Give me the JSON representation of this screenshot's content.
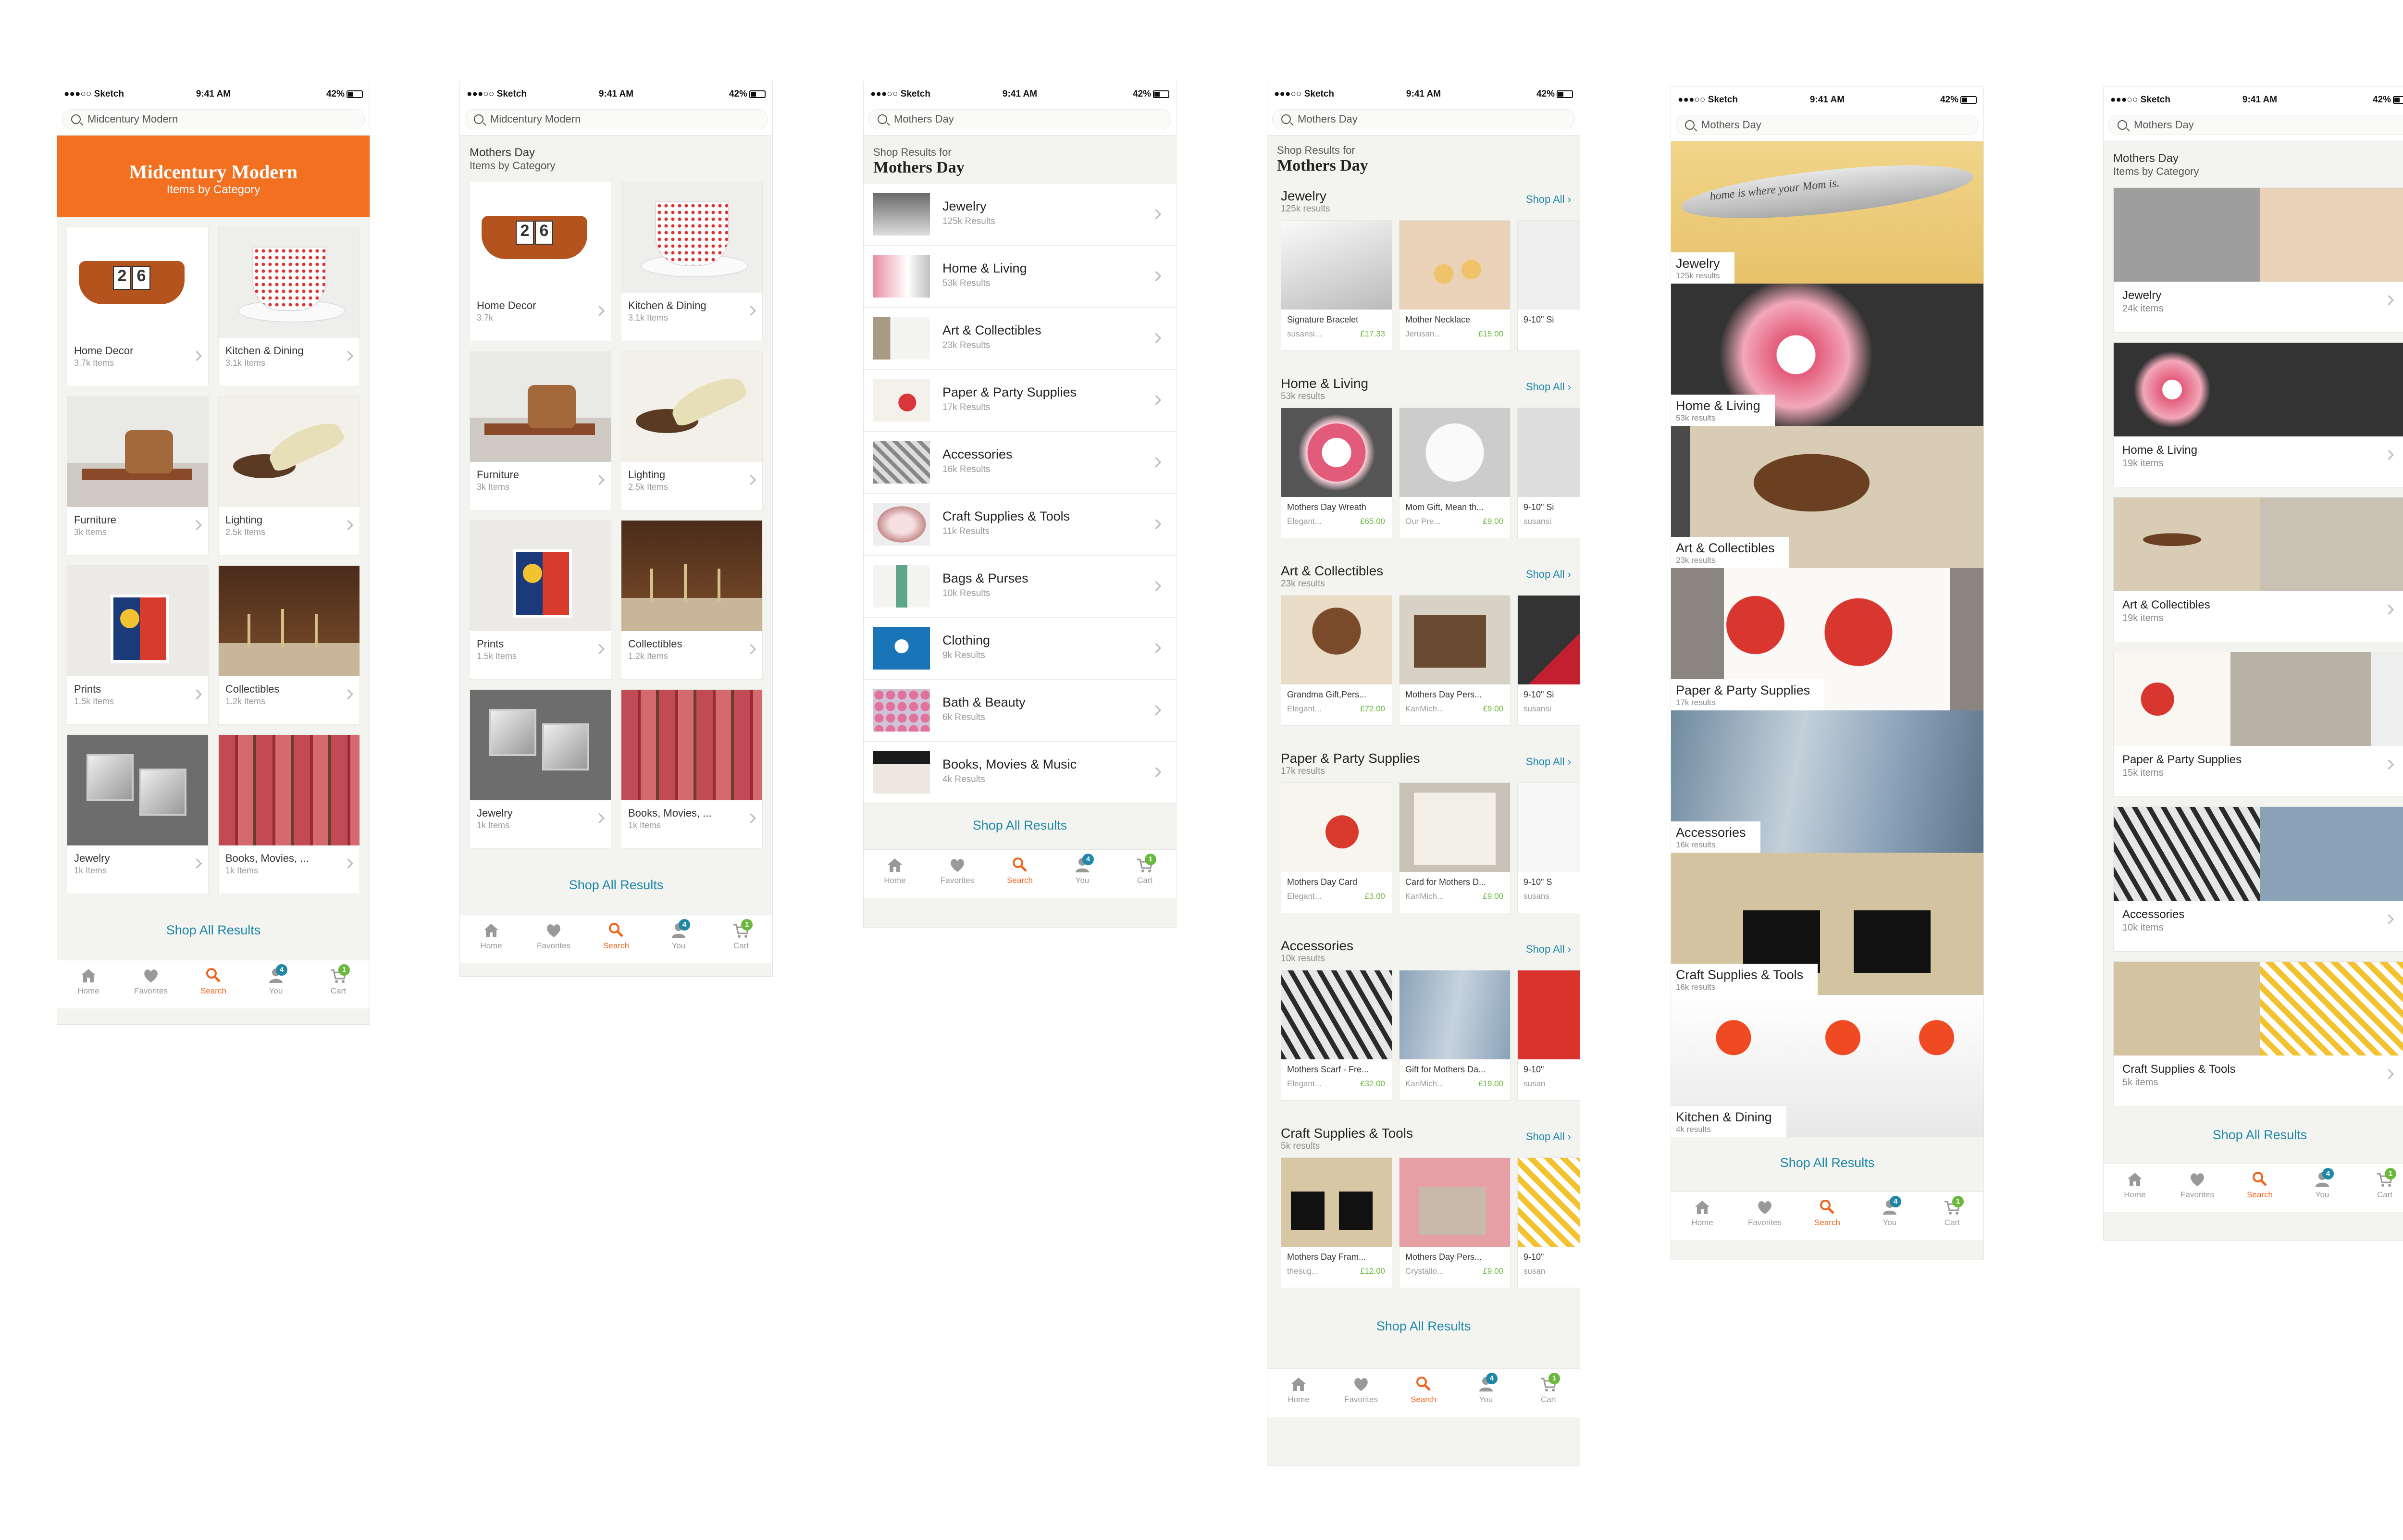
{
  "status": {
    "carrier": "●●●○○ Sketch",
    "time": "9:41 AM",
    "battery": "42%"
  },
  "tabs": [
    {
      "label": "Home",
      "icon": "home-icon"
    },
    {
      "label": "Favorites",
      "icon": "heart-icon"
    },
    {
      "label": "Search",
      "icon": "search-icon"
    },
    {
      "label": "You",
      "icon": "person-icon",
      "badge": "4"
    },
    {
      "label": "Cart",
      "icon": "cart-icon",
      "badge": "1"
    }
  ],
  "colors": {
    "accent": "#f1641e",
    "link": "#1f87a8",
    "price": "#6bb83e",
    "banner": "#f37021"
  },
  "screen1": {
    "search": "Midcentury Modern",
    "banner_title": "Midcentury Modern",
    "banner_sub": "Items by Category",
    "cards": [
      {
        "name": "Home Decor",
        "count": "3.7k Items"
      },
      {
        "name": "Kitchen & Dining",
        "count": "3.1k Items"
      },
      {
        "name": "Furniture",
        "count": "3k Items"
      },
      {
        "name": "Lighting",
        "count": "2.5k Items"
      },
      {
        "name": "Prints",
        "count": "1.5k Items"
      },
      {
        "name": "Collectibles",
        "count": "1.2k Items"
      },
      {
        "name": "Jewelry",
        "count": "1k Items"
      },
      {
        "name": "Books, Movies, ...",
        "count": "1k Items"
      }
    ],
    "shop_all": "Shop All Results"
  },
  "screen2": {
    "search": "Midcentury Modern",
    "title": "Mothers Day",
    "subtitle": "Items by Category",
    "cards": [
      {
        "name": "Home Decor",
        "count": "3.7k"
      },
      {
        "name": "Kitchen & Dining",
        "count": "3.1k Items"
      },
      {
        "name": "Furniture",
        "count": "3k Items"
      },
      {
        "name": "Lighting",
        "count": "2.5k Items"
      },
      {
        "name": "Prints",
        "count": "1.5k Items"
      },
      {
        "name": "Collectibles",
        "count": "1.2k Items"
      },
      {
        "name": "Jewelry",
        "count": "1k Items"
      },
      {
        "name": "Books, Movies, ...",
        "count": "1k Items"
      }
    ],
    "shop_all": "Shop All Results"
  },
  "screen3": {
    "search": "Mothers Day",
    "pre": "Shop Results for",
    "title": "Mothers Day",
    "rows": [
      {
        "name": "Jewelry",
        "count": "125k Results"
      },
      {
        "name": "Home & Living",
        "count": "53k Results"
      },
      {
        "name": "Art & Collectibles",
        "count": "23k Results"
      },
      {
        "name": "Paper & Party Supplies",
        "count": "17k Results"
      },
      {
        "name": "Accessories",
        "count": "16k Results"
      },
      {
        "name": "Craft Supplies & Tools",
        "count": "11k Results"
      },
      {
        "name": "Bags & Purses",
        "count": "10k Results"
      },
      {
        "name": "Clothing",
        "count": "9k Results"
      },
      {
        "name": "Bath & Beauty",
        "count": "6k Results"
      },
      {
        "name": "Books, Movies & Music",
        "count": "4k Results"
      }
    ],
    "shop_all": "Shop All Results"
  },
  "screen4": {
    "search": "Mothers Day",
    "pre": "Shop Results for",
    "title": "Mothers Day",
    "shop_link": "Shop All ›",
    "sections": [
      {
        "name": "Jewelry",
        "count": "125k results",
        "items": [
          {
            "title": "Signature Bracelet",
            "shop": "susansi...",
            "price": "£17.33"
          },
          {
            "title": "Mother Necklace",
            "shop": "Jerusan...",
            "price": "£15.00"
          },
          {
            "title": "9-10\" Si",
            "shop": "",
            "price": ""
          }
        ]
      },
      {
        "name": "Home & Living",
        "count": "53k results",
        "items": [
          {
            "title": "Mothers Day Wreath",
            "shop": "Elegant...",
            "price": "£65.00"
          },
          {
            "title": "Mom Gift, Mean th...",
            "shop": "Our Pre...",
            "price": "£9.00"
          },
          {
            "title": "9-10\" Si",
            "shop": "susansi",
            "price": ""
          }
        ]
      },
      {
        "name": "Art & Collectibles",
        "count": "23k results",
        "items": [
          {
            "title": "Grandma Gift,Pers...",
            "shop": "Elegant...",
            "price": "£72.00"
          },
          {
            "title": "Mothers Day Pers...",
            "shop": "KariMich...",
            "price": "£9.00"
          },
          {
            "title": "9-10\" Si",
            "shop": "susansi",
            "price": ""
          }
        ]
      },
      {
        "name": "Paper & Party Supplies",
        "count": "17k results",
        "items": [
          {
            "title": "Mothers Day Card",
            "shop": "Elegant...",
            "price": "£3.00"
          },
          {
            "title": "Card for Mothers D...",
            "shop": "KariMich...",
            "price": "£9.00"
          },
          {
            "title": "9-10\" S",
            "shop": "susans",
            "price": ""
          }
        ]
      },
      {
        "name": "Accessories",
        "count": "10k results",
        "items": [
          {
            "title": "Mothers Scarf - Fre...",
            "shop": "Elegant...",
            "price": "£32.00"
          },
          {
            "title": "Gift for Mothers Da...",
            "shop": "KariMich...",
            "price": "£19.00"
          },
          {
            "title": "9-10\"",
            "shop": "susan",
            "price": ""
          }
        ]
      },
      {
        "name": "Craft Supplies & Tools",
        "count": "5k results",
        "items": [
          {
            "title": "Mothers Day Fram...",
            "shop": "thesug...",
            "price": "£12.00"
          },
          {
            "title": "Mothers Day Pers...",
            "shop": "Crystallo...",
            "price": "£9.00"
          },
          {
            "title": "9-10\"",
            "shop": "susan",
            "price": ""
          }
        ]
      }
    ],
    "shop_all": "Shop All Results"
  },
  "screen5": {
    "search": "Mothers Day",
    "heroes": [
      {
        "name": "Jewelry",
        "count": "125k results",
        "caption": "home is where your Mom is."
      },
      {
        "name": "Home & Living",
        "count": "53k results"
      },
      {
        "name": "Art & Collectibles",
        "count": "23k results"
      },
      {
        "name": "Paper & Party Supplies",
        "count": "17k results"
      },
      {
        "name": "Accessories",
        "count": "16k results"
      },
      {
        "name": "Craft Supplies & Tools",
        "count": "16k results"
      },
      {
        "name": "Kitchen & Dining",
        "count": "4k results"
      }
    ],
    "shop_all": "Shop All Results"
  },
  "screen6": {
    "search": "Mothers Day",
    "title": "Mothers Day",
    "subtitle": "Items by Category",
    "cards": [
      {
        "name": "Jewelry",
        "count": "24k items"
      },
      {
        "name": "Home & Living",
        "count": "19k items"
      },
      {
        "name": "Art & Collectibles",
        "count": "19k items"
      },
      {
        "name": "Paper & Party Supplies",
        "count": "15k items"
      },
      {
        "name": "Accessories",
        "count": "10k items"
      },
      {
        "name": "Craft Supplies & Tools",
        "count": "5k items"
      }
    ],
    "shop_all": "Shop All Results"
  }
}
